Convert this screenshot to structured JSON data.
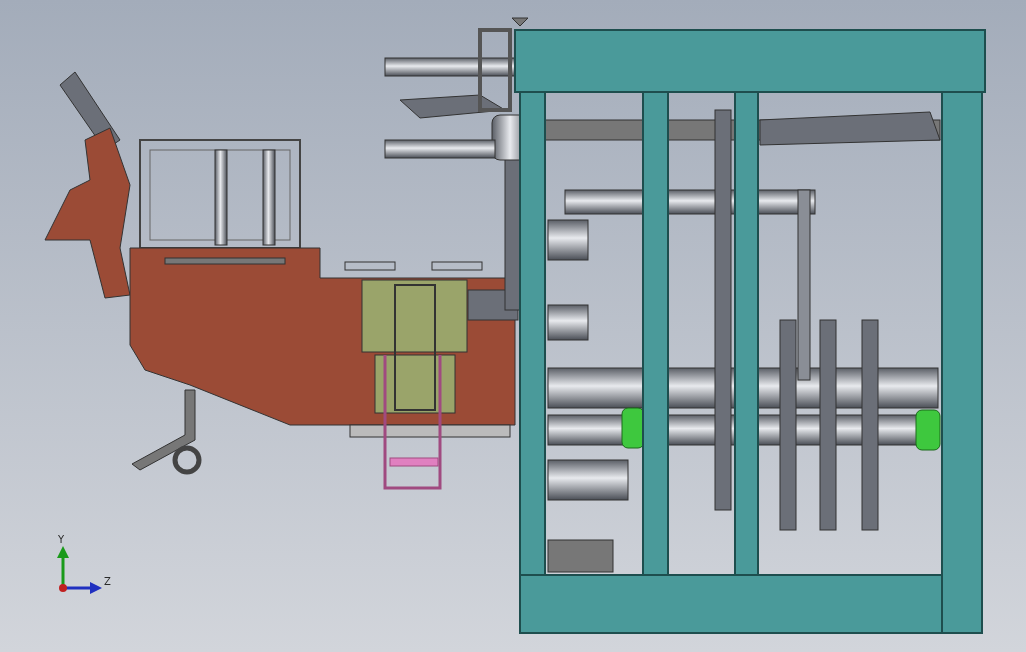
{
  "viewport": {
    "triad": {
      "axes": [
        {
          "label": "Y",
          "kind": "vertical"
        },
        {
          "label": "Z",
          "kind": "horizontal"
        }
      ]
    }
  }
}
